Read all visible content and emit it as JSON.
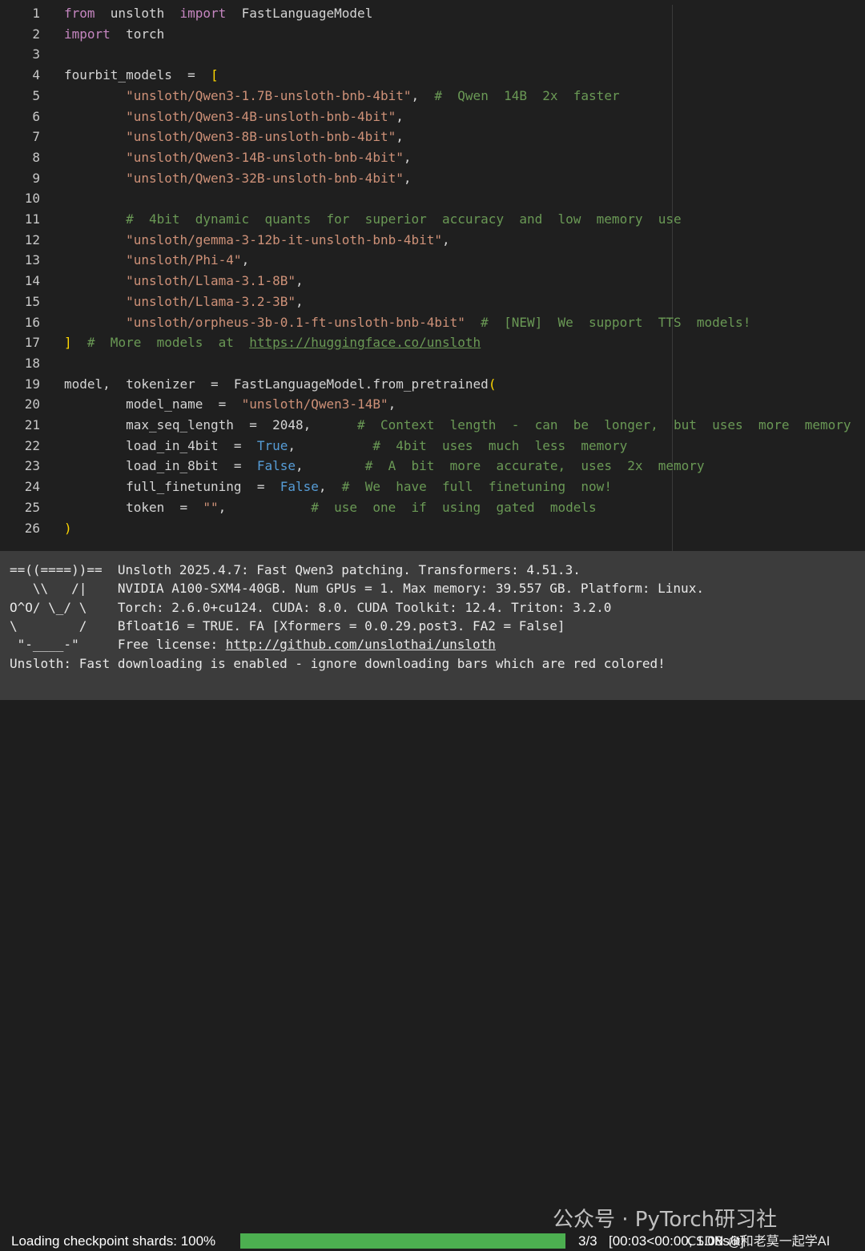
{
  "editor": {
    "lines": [
      {
        "n": "1",
        "segments": [
          {
            "t": "from",
            "c": "kw"
          },
          {
            "t": "  unsloth  ",
            "c": ""
          },
          {
            "t": "import",
            "c": "kw"
          },
          {
            "t": "  FastLanguageModel",
            "c": ""
          }
        ]
      },
      {
        "n": "2",
        "segments": [
          {
            "t": "import",
            "c": "kw"
          },
          {
            "t": "  torch",
            "c": ""
          }
        ]
      },
      {
        "n": "3",
        "segments": []
      },
      {
        "n": "4",
        "segments": [
          {
            "t": "fourbit_models  =  ",
            "c": ""
          },
          {
            "t": "[",
            "c": "paren"
          }
        ]
      },
      {
        "n": "5",
        "segments": [
          {
            "t": "        ",
            "c": ""
          },
          {
            "t": "\"unsloth/Qwen3-1.7B-unsloth-bnb-4bit\"",
            "c": "str"
          },
          {
            "t": ",  ",
            "c": ""
          },
          {
            "t": "#  Qwen  14B  2x  faster",
            "c": "com"
          }
        ]
      },
      {
        "n": "6",
        "segments": [
          {
            "t": "        ",
            "c": ""
          },
          {
            "t": "\"unsloth/Qwen3-4B-unsloth-bnb-4bit\"",
            "c": "str"
          },
          {
            "t": ",",
            "c": ""
          }
        ]
      },
      {
        "n": "7",
        "segments": [
          {
            "t": "        ",
            "c": ""
          },
          {
            "t": "\"unsloth/Qwen3-8B-unsloth-bnb-4bit\"",
            "c": "str"
          },
          {
            "t": ",",
            "c": ""
          }
        ]
      },
      {
        "n": "8",
        "segments": [
          {
            "t": "        ",
            "c": ""
          },
          {
            "t": "\"unsloth/Qwen3-14B-unsloth-bnb-4bit\"",
            "c": "str"
          },
          {
            "t": ",",
            "c": ""
          }
        ]
      },
      {
        "n": "9",
        "segments": [
          {
            "t": "        ",
            "c": ""
          },
          {
            "t": "\"unsloth/Qwen3-32B-unsloth-bnb-4bit\"",
            "c": "str"
          },
          {
            "t": ",",
            "c": ""
          }
        ]
      },
      {
        "n": "10",
        "segments": []
      },
      {
        "n": "11",
        "segments": [
          {
            "t": "        ",
            "c": ""
          },
          {
            "t": "#  4bit  dynamic  quants  for  superior  accuracy  and  low  memory  use",
            "c": "com"
          }
        ]
      },
      {
        "n": "12",
        "segments": [
          {
            "t": "        ",
            "c": ""
          },
          {
            "t": "\"unsloth/gemma-3-12b-it-unsloth-bnb-4bit\"",
            "c": "str"
          },
          {
            "t": ",",
            "c": ""
          }
        ]
      },
      {
        "n": "13",
        "segments": [
          {
            "t": "        ",
            "c": ""
          },
          {
            "t": "\"unsloth/Phi-4\"",
            "c": "str"
          },
          {
            "t": ",",
            "c": ""
          }
        ]
      },
      {
        "n": "14",
        "segments": [
          {
            "t": "        ",
            "c": ""
          },
          {
            "t": "\"unsloth/Llama-3.1-8B\"",
            "c": "str"
          },
          {
            "t": ",",
            "c": ""
          }
        ]
      },
      {
        "n": "15",
        "segments": [
          {
            "t": "        ",
            "c": ""
          },
          {
            "t": "\"unsloth/Llama-3.2-3B\"",
            "c": "str"
          },
          {
            "t": ",",
            "c": ""
          }
        ]
      },
      {
        "n": "16",
        "segments": [
          {
            "t": "        ",
            "c": ""
          },
          {
            "t": "\"unsloth/orpheus-3b-0.1-ft-unsloth-bnb-4bit\"",
            "c": "str"
          },
          {
            "t": "  ",
            "c": ""
          },
          {
            "t": "#  [NEW]  We  support  TTS  models!",
            "c": "com"
          }
        ]
      },
      {
        "n": "17",
        "segments": [
          {
            "t": "]",
            "c": "paren"
          },
          {
            "t": "  ",
            "c": ""
          },
          {
            "t": "#  More  models  at  ",
            "c": "com"
          },
          {
            "t": "https://huggingface.co/unsloth",
            "c": "link"
          }
        ]
      },
      {
        "n": "18",
        "segments": []
      },
      {
        "n": "19",
        "segments": [
          {
            "t": "model,  tokenizer  =  FastLanguageModel.from_pretrained",
            "c": ""
          },
          {
            "t": "(",
            "c": "paren"
          }
        ]
      },
      {
        "n": "20",
        "segments": [
          {
            "t": "        model_name  =  ",
            "c": ""
          },
          {
            "t": "\"unsloth/Qwen3-14B\"",
            "c": "str"
          },
          {
            "t": ",",
            "c": ""
          }
        ]
      },
      {
        "n": "21",
        "segments": [
          {
            "t": "        max_seq_length  =  2048,      ",
            "c": ""
          },
          {
            "t": "#  Context  length  -  can  be  longer,  but  uses  more  memory",
            "c": "com"
          }
        ]
      },
      {
        "n": "22",
        "segments": [
          {
            "t": "        load_in_4bit  =  ",
            "c": ""
          },
          {
            "t": "True",
            "c": "bool"
          },
          {
            "t": ",          ",
            "c": ""
          },
          {
            "t": "#  4bit  uses  much  less  memory",
            "c": "com"
          }
        ]
      },
      {
        "n": "23",
        "segments": [
          {
            "t": "        load_in_8bit  =  ",
            "c": ""
          },
          {
            "t": "False",
            "c": "bool"
          },
          {
            "t": ",        ",
            "c": ""
          },
          {
            "t": "#  A  bit  more  accurate,  uses  2x  memory",
            "c": "com"
          }
        ]
      },
      {
        "n": "24",
        "segments": [
          {
            "t": "        full_finetuning  =  ",
            "c": ""
          },
          {
            "t": "False",
            "c": "bool"
          },
          {
            "t": ",  ",
            "c": ""
          },
          {
            "t": "#  We  have  full  finetuning  now!",
            "c": "com"
          }
        ]
      },
      {
        "n": "25",
        "segments": [
          {
            "t": "        token  =  ",
            "c": ""
          },
          {
            "t": "\"\"",
            "c": "str"
          },
          {
            "t": ",           ",
            "c": ""
          },
          {
            "t": "#  use  one  if  using  gated  models",
            "c": "com"
          }
        ]
      },
      {
        "n": "26",
        "segments": [
          {
            "t": ")",
            "c": "paren"
          }
        ]
      }
    ]
  },
  "output": {
    "lines": [
      {
        "text": "==((====))==  Unsloth 2025.4.7: Fast Qwen3 patching. Transformers: 4.51.3."
      },
      {
        "text": "   \\\\   /|    NVIDIA A100-SXM4-40GB. Num GPUs = 1. Max memory: 39.557 GB. Platform: Linux."
      },
      {
        "text": "O^O/ \\_/ \\    Torch: 2.6.0+cu124. CUDA: 8.0. CUDA Toolkit: 12.4. Triton: 3.2.0"
      },
      {
        "text": "\\        /    Bfloat16 = TRUE. FA [Xformers = 0.0.29.post3. FA2 = False]"
      },
      {
        "text": " \"-____-\"     Free license: ",
        "link": "http://github.com/unslothai/unsloth"
      },
      {
        "text": "Unsloth: Fast downloading is enabled - ignore downloading bars which are red colored!"
      }
    ],
    "progress": {
      "label": "Loading checkpoint shards: 100%",
      "fraction": 1.0,
      "count": "3/3",
      "timing": "[00:03<00:00,  1.08s/it]",
      "color": "#4caf50"
    }
  },
  "watermark": {
    "main": "公众号 · PyTorch研习社",
    "site": "CSDN @和老莫一起学AI"
  }
}
